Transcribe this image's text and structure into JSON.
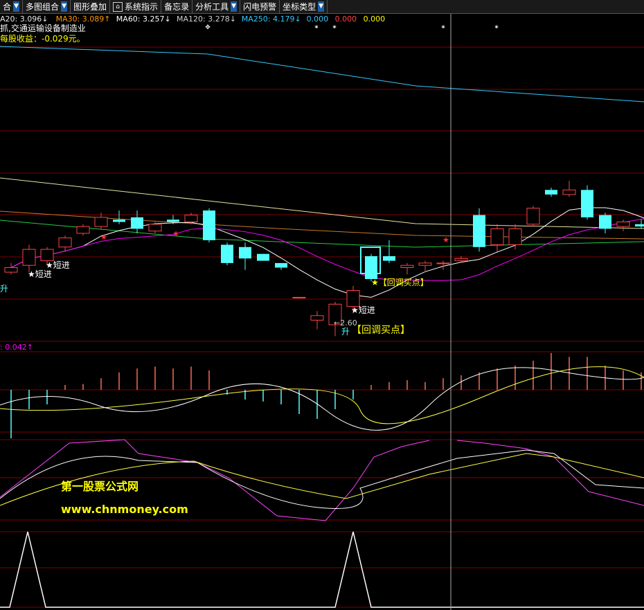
{
  "toolbar": {
    "items": [
      {
        "label": "合",
        "has_menu": true
      },
      {
        "label": "多图组合",
        "has_menu": true
      },
      {
        "label": "图形叠加",
        "has_menu": false
      },
      {
        "label": "系统指示",
        "has_menu": false,
        "icon": "lock-icon"
      },
      {
        "label": "备忘录",
        "has_menu": false
      },
      {
        "label": "分析工具",
        "has_menu": true
      },
      {
        "label": "闪电预警",
        "has_menu": false
      },
      {
        "label": "坐标类型",
        "has_menu": true
      }
    ]
  },
  "ma_line": [
    {
      "text": "A20: 3.096↓",
      "color": "#e8e8e8"
    },
    {
      "text": "MA30: 3.089↑",
      "color": "#ff9900"
    },
    {
      "text": "MA60: 3.257↓",
      "color": "#ffffff"
    },
    {
      "text": "MA120: 3.278↓",
      "color": "#cfcfcf"
    },
    {
      "text": "MA250: 4.179↓",
      "color": "#35c8ff"
    },
    {
      "text": "0.000",
      "color": "#35c8ff"
    },
    {
      "text": "0.000",
      "color": "#ff4444"
    },
    {
      "text": "0.000",
      "color": "#ffff00"
    }
  ],
  "info": {
    "industry": "抓,交通运输设备制造业",
    "eps": "每股收益：-0.029元。"
  },
  "signals": {
    "short_entry": "★短进",
    "pullback_buy": "【回调买点】",
    "overlap_buy": "★【回调买点】",
    "low_price": "←2.60",
    "up_label": "升",
    "rise_label": "升"
  },
  "macd": {
    "label": ": 0.042↑"
  },
  "watermark": {
    "title": "第一股票公式网",
    "url": "www.chnmoney.com"
  },
  "colors": {
    "up": "#ff4444",
    "down": "#55ffff",
    "ma5": "#ffffff",
    "ma10": "#ffff00",
    "ma20": "#ff00ff",
    "ma250": "#35c8ff",
    "grid": "#800000"
  },
  "chart_data": {
    "type": "candlestick",
    "ohlc": [
      {
        "o": 3.03,
        "h": 3.07,
        "l": 3.02,
        "c": 3.05
      },
      {
        "o": 3.06,
        "h": 3.15,
        "l": 3.03,
        "c": 3.13
      },
      {
        "o": 3.08,
        "h": 3.14,
        "l": 3.06,
        "c": 3.13
      },
      {
        "o": 3.14,
        "h": 3.19,
        "l": 3.12,
        "c": 3.18
      },
      {
        "o": 3.2,
        "h": 3.24,
        "l": 3.19,
        "c": 3.23
      },
      {
        "o": 3.23,
        "h": 3.29,
        "l": 3.22,
        "c": 3.27
      },
      {
        "o": 3.26,
        "h": 3.3,
        "l": 3.24,
        "c": 3.25
      },
      {
        "o": 3.27,
        "h": 3.3,
        "l": 3.2,
        "c": 3.22
      },
      {
        "o": 3.21,
        "h": 3.25,
        "l": 3.2,
        "c": 3.24
      },
      {
        "o": 3.26,
        "h": 3.28,
        "l": 3.24,
        "c": 3.25
      },
      {
        "o": 3.25,
        "h": 3.29,
        "l": 3.24,
        "c": 3.28
      },
      {
        "o": 3.3,
        "h": 3.31,
        "l": 3.16,
        "c": 3.17
      },
      {
        "o": 3.15,
        "h": 3.16,
        "l": 3.06,
        "c": 3.07
      },
      {
        "o": 3.14,
        "h": 3.16,
        "l": 3.04,
        "c": 3.09
      },
      {
        "o": 3.11,
        "h": 3.11,
        "l": 3.08,
        "c": 3.08
      },
      {
        "o": 3.07,
        "h": 3.07,
        "l": 3.04,
        "c": 3.05
      },
      {
        "o": 2.92,
        "h": 2.92,
        "l": 2.92,
        "c": 2.92
      },
      {
        "o": 2.82,
        "h": 2.86,
        "l": 2.78,
        "c": 2.84
      },
      {
        "o": 2.8,
        "h": 2.9,
        "l": 2.75,
        "c": 2.89
      },
      {
        "o": 2.88,
        "h": 2.97,
        "l": 2.85,
        "c": 2.95
      },
      {
        "o": 3.1,
        "h": 3.11,
        "l": 2.99,
        "c": 3.0
      },
      {
        "o": 3.1,
        "h": 3.17,
        "l": 3.07,
        "c": 3.08
      },
      {
        "o": 3.05,
        "h": 3.07,
        "l": 3.02,
        "c": 3.06
      },
      {
        "o": 3.06,
        "h": 3.08,
        "l": 3.03,
        "c": 3.07
      },
      {
        "o": 3.07,
        "h": 3.08,
        "l": 3.04,
        "c": 3.07
      },
      {
        "o": 3.08,
        "h": 3.1,
        "l": 3.07,
        "c": 3.09
      },
      {
        "o": 3.28,
        "h": 3.31,
        "l": 3.12,
        "c": 3.14
      },
      {
        "o": 3.15,
        "h": 3.24,
        "l": 3.12,
        "c": 3.22
      },
      {
        "o": 3.15,
        "h": 3.24,
        "l": 3.13,
        "c": 3.22
      },
      {
        "o": 3.24,
        "h": 3.32,
        "l": 3.23,
        "c": 3.31
      },
      {
        "o": 3.39,
        "h": 3.4,
        "l": 3.36,
        "c": 3.37
      },
      {
        "o": 3.37,
        "h": 3.43,
        "l": 3.36,
        "c": 3.39
      },
      {
        "o": 3.39,
        "h": 3.41,
        "l": 3.26,
        "c": 3.27
      },
      {
        "o": 3.28,
        "h": 3.29,
        "l": 3.2,
        "c": 3.22
      },
      {
        "o": 3.23,
        "h": 3.26,
        "l": 3.21,
        "c": 3.25
      },
      {
        "o": 3.24,
        "h": 3.26,
        "l": 3.22,
        "c": 3.23
      },
      {
        "o": 3.24,
        "h": 3.26,
        "l": 3.21,
        "c": 3.22
      }
    ],
    "macd_hist": [
      -0.05,
      -0.02,
      -0.015,
      0.005,
      0.006,
      0.012,
      0.018,
      0.022,
      0.024,
      0.022,
      0.024,
      0.02,
      -0.005,
      -0.01,
      -0.012,
      -0.015,
      -0.025,
      -0.03,
      -0.02,
      -0.01,
      0.005,
      0.008,
      0.01,
      0.008,
      0.012,
      0.015,
      0.018,
      0.022,
      0.025,
      0.03,
      0.038,
      0.034,
      0.034,
      0.025,
      0.02,
      0.018,
      0.015
    ],
    "trigger_peaks_x": [
      40,
      510
    ]
  }
}
